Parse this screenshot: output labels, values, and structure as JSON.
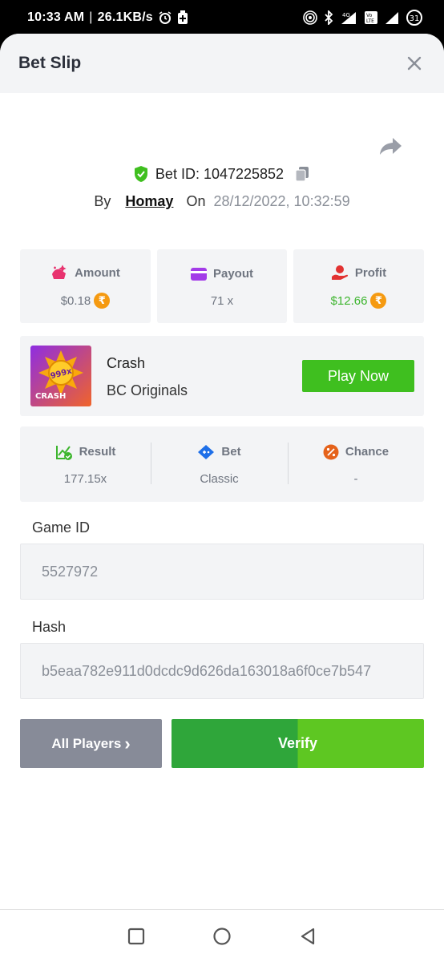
{
  "status_bar": {
    "time": "10:33 AM",
    "speed": "26.1KB/s",
    "battery": "31",
    "icons": [
      "alarm-icon",
      "battery-saver-icon",
      "hotspot-icon",
      "bluetooth-icon",
      "signal-4g-icon",
      "volte-icon",
      "signal-icon",
      "battery-icon"
    ]
  },
  "header": {
    "title": "Bet Slip"
  },
  "bet": {
    "id_label": "Bet ID: 1047225852",
    "by_label": "By",
    "user": "Homay",
    "on_label": "On",
    "datetime": "28/12/2022, 10:32:59"
  },
  "stats": {
    "amount": {
      "label": "Amount",
      "value": "$0.18",
      "currency_symbol": "₹"
    },
    "payout": {
      "label": "Payout",
      "value": "71 x"
    },
    "profit": {
      "label": "Profit",
      "value": "$12.66",
      "currency_symbol": "₹"
    }
  },
  "game": {
    "name": "Crash",
    "provider": "BC Originals",
    "play_label": "Play Now",
    "thumb_badge": "999x",
    "thumb_text": "CRASH"
  },
  "result": {
    "result": {
      "label": "Result",
      "value": "177.15x"
    },
    "bet": {
      "label": "Bet",
      "value": "Classic"
    },
    "chance": {
      "label": "Chance",
      "value": "-"
    }
  },
  "fields": {
    "game_id": {
      "label": "Game ID",
      "value": "5527972"
    },
    "hash": {
      "label": "Hash",
      "value": "b5eaa782e911d0dcdc9d626da163018a6f0ce7b547"
    }
  },
  "actions": {
    "all_players": "All Players",
    "all_players_chevron": "›",
    "verify": "Verify"
  },
  "colors": {
    "accent_green": "#3fbf1f",
    "profit_green": "#3db52e",
    "coin": "#f59a11",
    "amount_icon": "#e8336f",
    "payout_icon": "#a33be8",
    "profit_icon": "#e23232",
    "result_icon": "#3db52e",
    "bet_icon": "#1e6fe8",
    "chance_icon": "#e5621a"
  }
}
